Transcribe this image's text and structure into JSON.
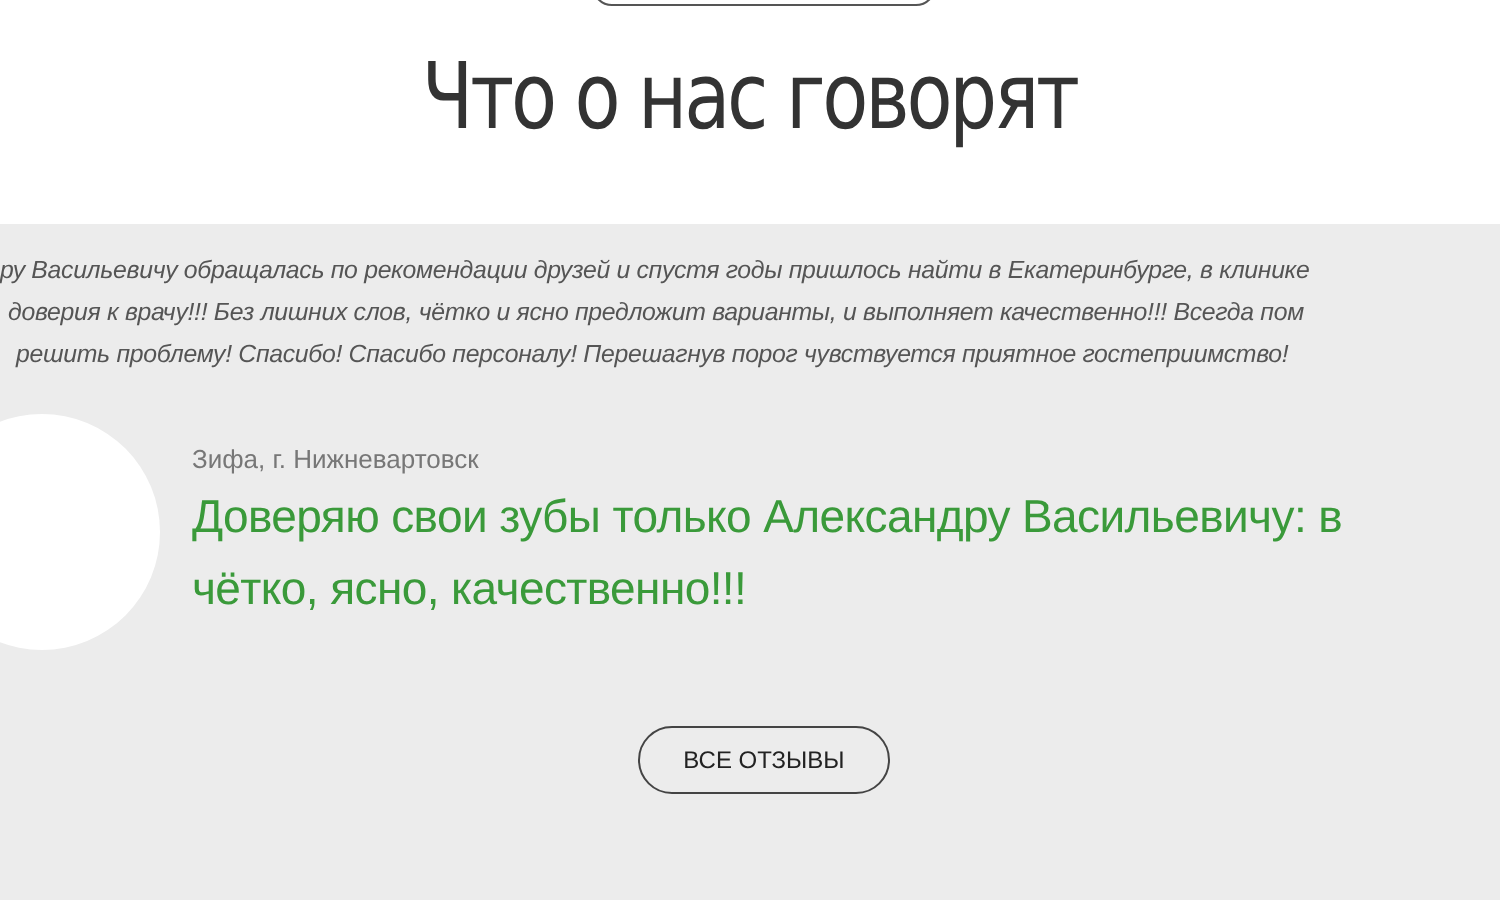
{
  "heading": "Что о нас говорят",
  "review_text": [
    "ру Васильевичу обращалась по рекомендации друзей и спустя годы пришлось найти в Екатеринбурге, в клинике",
    "доверия к врачу!!! Без лишних слов, чётко и ясно предложит варианты, и выполняет качественно!!! Всегда пом",
    "решить проблему! Спасибо! Спасибо персоналу! Перешагнув порог чувствуется приятное гостеприимство!"
  ],
  "author": "Зифа, г. Нижневартовск",
  "quote": [
    "Доверяю свои зубы только Александру Васильевичу: в",
    "чётко, ясно, качественно!!!"
  ],
  "all_reviews_button": "ВСЕ ОТЗЫВЫ"
}
